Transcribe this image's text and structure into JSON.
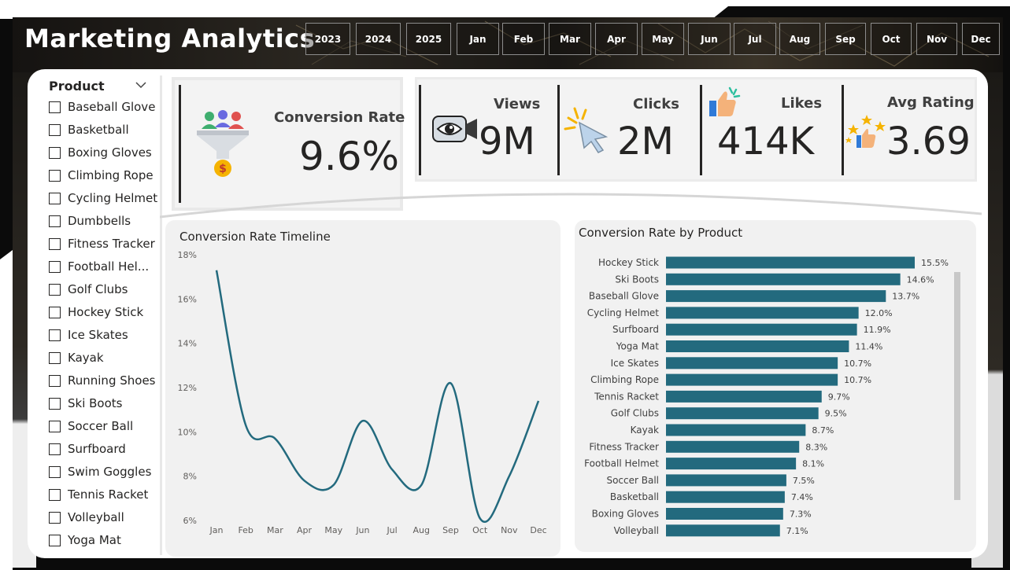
{
  "header": {
    "title": "Marketing Analytics",
    "periods": [
      "2023",
      "2024",
      "2025",
      "Jan",
      "Feb",
      "Mar",
      "Apr",
      "May",
      "Jun",
      "Jul",
      "Aug",
      "Sep",
      "Oct",
      "Nov",
      "Dec"
    ]
  },
  "slicer": {
    "title": "Product",
    "items": [
      "Baseball Glove",
      "Basketball",
      "Boxing Gloves",
      "Climbing Rope",
      "Cycling Helmet",
      "Dumbbells",
      "Fitness Tracker",
      "Football Hel...",
      "Golf Clubs",
      "Hockey Stick",
      "Ice Skates",
      "Kayak",
      "Running Shoes",
      "Ski Boots",
      "Soccer Ball",
      "Surfboard",
      "Swim Goggles",
      "Tennis Racket",
      "Volleyball",
      "Yoga Mat"
    ]
  },
  "kpis": {
    "conversion": {
      "label": "Conversion Rate",
      "value": "9.6%"
    },
    "views": {
      "label": "Views",
      "value": "9M"
    },
    "clicks": {
      "label": "Clicks",
      "value": "2M"
    },
    "likes": {
      "label": "Likes",
      "value": "414K"
    },
    "rating": {
      "label": "Avg Rating",
      "value": "3.69"
    }
  },
  "icons": {
    "conversion": "funnel-people-dollar-icon",
    "views": "eye-camera-icon",
    "clicks": "cursor-click-icon",
    "likes": "thumbs-up-icon",
    "rating": "stars-thumbs-up-icon"
  },
  "colors": {
    "accent": "#236a7e",
    "text": "#252423"
  },
  "chart_data": [
    {
      "type": "line",
      "title": "Conversion Rate Timeline",
      "x": [
        "Jan",
        "Feb",
        "Mar",
        "Apr",
        "May",
        "Jun",
        "Jul",
        "Aug",
        "Sep",
        "Oct",
        "Nov",
        "Dec"
      ],
      "values": [
        17.3,
        10.3,
        9.7,
        7.8,
        7.6,
        10.5,
        8.3,
        7.6,
        12.2,
        6.1,
        8.0,
        11.4
      ],
      "yticks": [
        "6%",
        "8%",
        "10%",
        "12%",
        "14%",
        "16%",
        "18%"
      ],
      "ylim": [
        6,
        18
      ]
    },
    {
      "type": "bar",
      "orientation": "horizontal",
      "title": "Conversion Rate by Product",
      "categories": [
        "Hockey Stick",
        "Ski Boots",
        "Baseball Glove",
        "Cycling Helmet",
        "Surfboard",
        "Yoga Mat",
        "Ice Skates",
        "Climbing Rope",
        "Tennis Racket",
        "Golf Clubs",
        "Kayak",
        "Fitness Tracker",
        "Football Helmet",
        "Soccer Ball",
        "Basketball",
        "Boxing Gloves",
        "Volleyball"
      ],
      "values": [
        15.5,
        14.6,
        13.7,
        12.0,
        11.9,
        11.4,
        10.7,
        10.7,
        9.7,
        9.5,
        8.7,
        8.3,
        8.1,
        7.5,
        7.4,
        7.3,
        7.1
      ],
      "labels": [
        "15.5%",
        "14.6%",
        "13.7%",
        "12.0%",
        "11.9%",
        "11.4%",
        "10.7%",
        "10.7%",
        "9.7%",
        "9.5%",
        "8.7%",
        "8.3%",
        "8.1%",
        "7.5%",
        "7.4%",
        "7.3%",
        "7.1%"
      ]
    }
  ]
}
